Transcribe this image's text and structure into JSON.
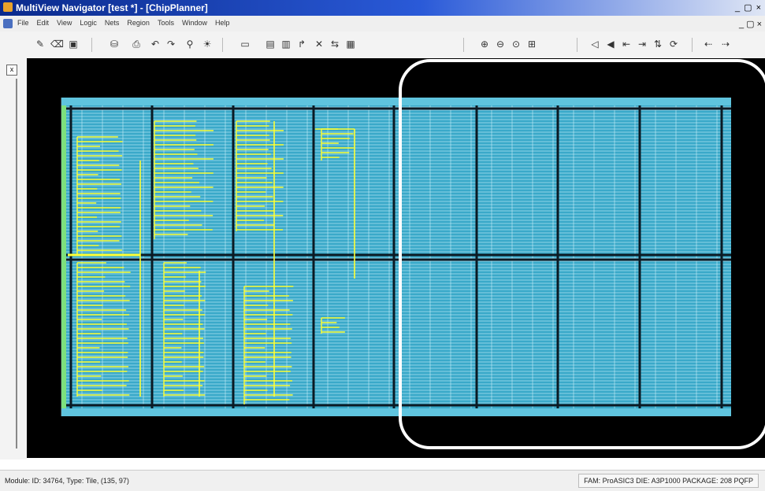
{
  "window": {
    "title": "MultiView Navigator [test *] - [ChipPlanner]",
    "controls": "_ ▢ ×"
  },
  "menu": {
    "items": [
      "File",
      "Edit",
      "View",
      "Logic",
      "Nets",
      "Region",
      "Tools",
      "Window",
      "Help"
    ]
  },
  "toolbar": {
    "icons": [
      "pencil-icon",
      "eraser-icon",
      "save-icon",
      "database-icon",
      "print-icon",
      "undo-icon",
      "redo-icon",
      "binoculars-icon",
      "bulb-icon",
      "folder-icon",
      "region-icon",
      "layers-icon",
      "route-icon",
      "cross-icon",
      "net-icon",
      "grid-icon",
      "zoom-in-icon",
      "zoom-out-icon",
      "zoom-fit-icon",
      "zoom-area-icon",
      "arrow-left-icon",
      "arrow-left2-icon",
      "align-left-icon",
      "align-right-icon",
      "flip-icon",
      "rotate-icon",
      "step-back-icon",
      "step-forward-icon"
    ]
  },
  "left_panel": {
    "close_label": "x"
  },
  "status": {
    "left": "Module: ID: 34764, Type: Tile, (135, 97)",
    "right": "FAM: ProASIC3  DIE: A3P1000  PACKAGE: 208 PQFP"
  },
  "colors": {
    "canvas_bg": "#000000",
    "tile": "#8fd3e8",
    "tile_dark": "#3aa9c9",
    "logic": "#ffff33",
    "highlight": "#ffffff"
  }
}
